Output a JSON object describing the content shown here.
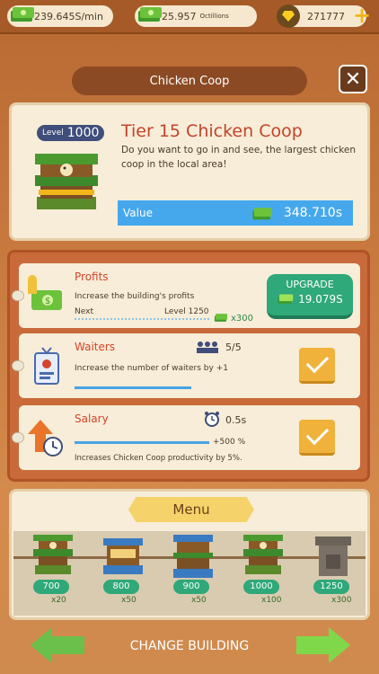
{
  "topbar": {
    "income": "239.645S/min",
    "cash": "25.957",
    "cash_unit": "Octillions",
    "gems": "271777"
  },
  "dialog": {
    "title": "Chicken Coop",
    "level_label": "Level",
    "level_value": "1000",
    "tier_title": "Tier 15 Chicken Coop",
    "description": "Do you want to go in and see, the largest chicken coop in the local area!",
    "value_label": "Value",
    "value_amount": "348.710s"
  },
  "upgrades": {
    "profits": {
      "title": "Profits",
      "desc": "Increase the building's profits",
      "next_label": "Next",
      "next_level": "Level 1250",
      "bonus": "x300",
      "upgrade_label": "UPGRADE",
      "upgrade_cost": "19.079S"
    },
    "waiters": {
      "title": "Waiters",
      "count": "5/5",
      "desc": "Increase the number of waiters by +1"
    },
    "salary": {
      "title": "Salary",
      "time": "0.5s",
      "bonus": "+500 %",
      "desc": "Increases Chicken Coop productivity by 5%."
    }
  },
  "menu": {
    "title": "Menu",
    "items": [
      {
        "price": "700",
        "mult": "x20"
      },
      {
        "price": "800",
        "mult": "x50"
      },
      {
        "price": "900",
        "mult": "x50"
      },
      {
        "price": "1000",
        "mult": "x100"
      },
      {
        "price": "1250",
        "mult": "x300"
      }
    ]
  },
  "footer": {
    "change_label": "CHANGE BUILDING"
  }
}
